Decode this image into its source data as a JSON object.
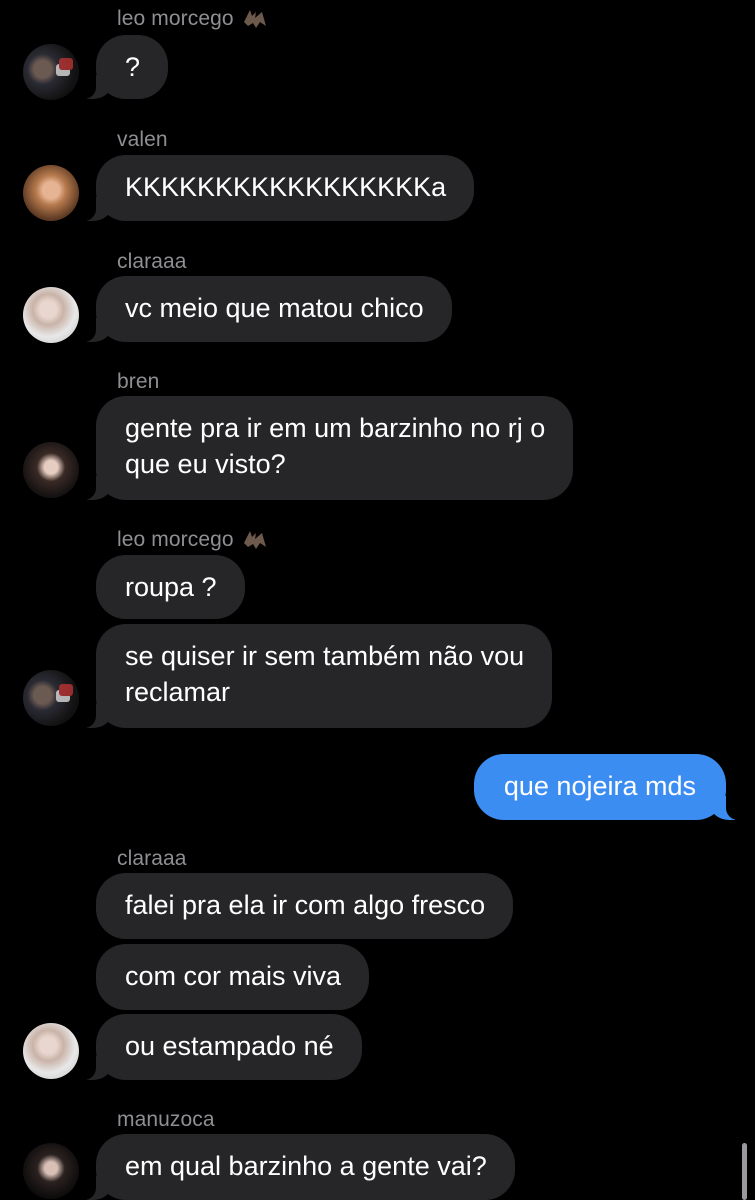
{
  "messages": {
    "s1": {
      "sender": "leo morcego",
      "b1": "?"
    },
    "s2": {
      "sender": "valen",
      "b1": "KKKKKKKKKKKKKKKKKa"
    },
    "s3": {
      "sender": "claraaa",
      "b1": "vc meio que matou chico"
    },
    "s4": {
      "sender": "bren",
      "b1": "gente pra ir em um barzinho no rj o",
      "b2": "que eu visto?"
    },
    "s5": {
      "sender": "leo morcego",
      "b1": "roupa ?",
      "b2a": "se quiser ir sem também não vou",
      "b2b": "reclamar"
    },
    "out": {
      "b1": "que nojeira mds"
    },
    "s6": {
      "sender": "claraaa",
      "b1": "falei pra ela ir com algo fresco",
      "b2": "com cor mais viva",
      "b3": "ou estampado né"
    },
    "s7": {
      "sender": "manuzoca",
      "b1": "em qual barzinho a gente vai?"
    }
  },
  "colors": {
    "background": "#000000",
    "incoming_bubble": "#262629",
    "outgoing_bubble": "#3b8df2",
    "sender_name": "#8e8e93"
  },
  "icons": {
    "bat": "bat-emoji-icon"
  }
}
